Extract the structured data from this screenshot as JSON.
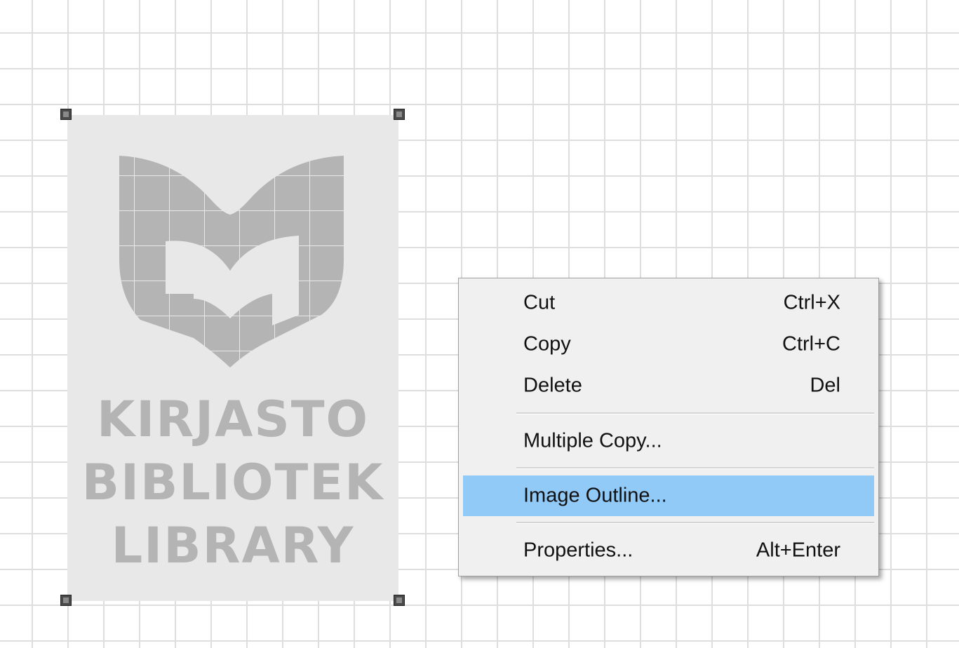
{
  "image_object": {
    "logo_lines": [
      "KIRJASTO",
      "BIBLIOTEK",
      "LIBRARY"
    ]
  },
  "context_menu": {
    "items": [
      {
        "label": "Cut",
        "shortcut": "Ctrl+X"
      },
      {
        "label": "Copy",
        "shortcut": "Ctrl+C"
      },
      {
        "label": "Delete",
        "shortcut": "Del"
      },
      {
        "label": "Multiple Copy...",
        "shortcut": ""
      },
      {
        "label": "Image Outline...",
        "shortcut": ""
      },
      {
        "label": "Properties...",
        "shortcut": "Alt+Enter"
      }
    ],
    "highlighted_item": "Image Outline..."
  },
  "colors": {
    "highlight": "#91c9f7",
    "menu_background": "#f0f0f0",
    "grid_line": "#dedede",
    "logo_fill": "#b4b4b4",
    "image_background": "#e8e8e8"
  }
}
